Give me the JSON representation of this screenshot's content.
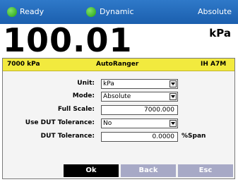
{
  "status": {
    "items": [
      "Ready",
      "Dynamic"
    ],
    "mode": "Absolute"
  },
  "reading": {
    "value": "100.01",
    "unit": "kPa"
  },
  "dialog": {
    "header": {
      "range": "7000 kPa",
      "title": "AutoRanger",
      "device": "IH A7M"
    },
    "fields": {
      "unit": {
        "label": "Unit:",
        "value": "kPa"
      },
      "mode": {
        "label": "Mode:",
        "value": "Absolute"
      },
      "full_scale": {
        "label": "Full Scale:",
        "value": "7000.000"
      },
      "use_dut_tol": {
        "label": "Use DUT Tolerance:",
        "value": "No"
      },
      "dut_tol": {
        "label": "DUT Tolerance:",
        "value": "0.0000",
        "suffix": "%Span"
      }
    },
    "buttons": {
      "ok": "Ok",
      "back": "Back",
      "esc": "Esc"
    }
  }
}
